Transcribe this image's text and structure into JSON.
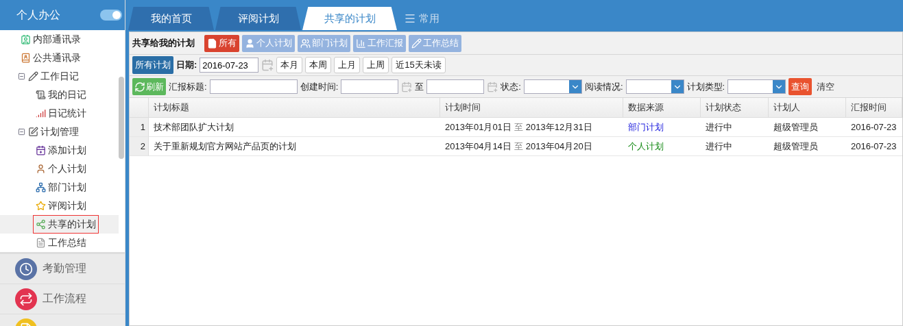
{
  "sidebar": {
    "title": "个人办公",
    "toggle_on": true,
    "tree": [
      {
        "label": "内部通讯录",
        "selected": false
      },
      {
        "label": "公共通讯录",
        "selected": false
      },
      {
        "label": "工作日记",
        "selected": false,
        "expanded": true,
        "children": [
          {
            "label": "我的日记",
            "selected": false
          },
          {
            "label": "日记统计",
            "selected": false
          }
        ]
      },
      {
        "label": "计划管理",
        "selected": false,
        "expanded": true,
        "children": [
          {
            "label": "添加计划",
            "selected": false
          },
          {
            "label": "个人计划",
            "selected": false
          },
          {
            "label": "部门计划",
            "selected": false
          },
          {
            "label": "评阅计划",
            "selected": false
          },
          {
            "label": "共享的计划",
            "selected": true
          },
          {
            "label": "工作总结",
            "selected": false
          }
        ]
      }
    ],
    "sections": [
      {
        "label": "考勤管理",
        "color": "#5a73a6"
      },
      {
        "label": "工作流程",
        "color": "#e23450"
      },
      {
        "color": "#f0c020"
      }
    ]
  },
  "tabs": [
    {
      "label": "我的首页",
      "selected": false
    },
    {
      "label": "评阅计划",
      "selected": false
    },
    {
      "label": "共享的计划",
      "selected": true
    }
  ],
  "tabs_menu": "常用",
  "panel": {
    "title": "共享给我的计划",
    "type_buttons": [
      {
        "label": "所有",
        "selected": true
      },
      {
        "label": "个人计划",
        "selected": false
      },
      {
        "label": "部门计划",
        "selected": false
      },
      {
        "label": "工作汇报",
        "selected": false
      },
      {
        "label": "工作总结",
        "selected": false
      }
    ],
    "scope_button": {
      "label": "所有计划",
      "selected": true
    },
    "date_label": "日期:",
    "date_value": "2016-07-23",
    "period_buttons": [
      "本月",
      "本周",
      "上月",
      "上周",
      "近15天未读"
    ],
    "refresh": "刷新",
    "filters": [
      {
        "kind": "text",
        "label": "汇报标题:"
      },
      {
        "kind": "date",
        "label": "创建时间:"
      },
      {
        "kind": "date",
        "label": "至"
      },
      {
        "kind": "select",
        "label": "状态:"
      },
      {
        "kind": "select",
        "label": "阅读情况:"
      },
      {
        "kind": "select",
        "label": "计划类型:"
      }
    ],
    "query": "查询",
    "clear": "清空"
  },
  "table": {
    "columns": [
      "计划标题",
      "计划时间",
      "数据来源",
      "计划状态",
      "计划人",
      "汇报时间"
    ],
    "rows": [
      {
        "number": "1",
        "title": "技术部团队扩大计划",
        "start": "2013年01月01日",
        "to": "至",
        "end": "2013年12月31日",
        "source": {
          "label": "部门计划",
          "kind": "department"
        },
        "status": "进行中",
        "planner": "超级管理员",
        "reported": "2016-07-23"
      },
      {
        "number": "2",
        "title": "关于重新规划官方网站产品页的计划",
        "start": "2013年04月14日",
        "to": "至",
        "end": "2013年04月20日",
        "source": {
          "label": "个人计划",
          "kind": "personal"
        },
        "status": "进行中",
        "planner": "超级管理员",
        "reported": "2016-07-23"
      }
    ]
  }
}
